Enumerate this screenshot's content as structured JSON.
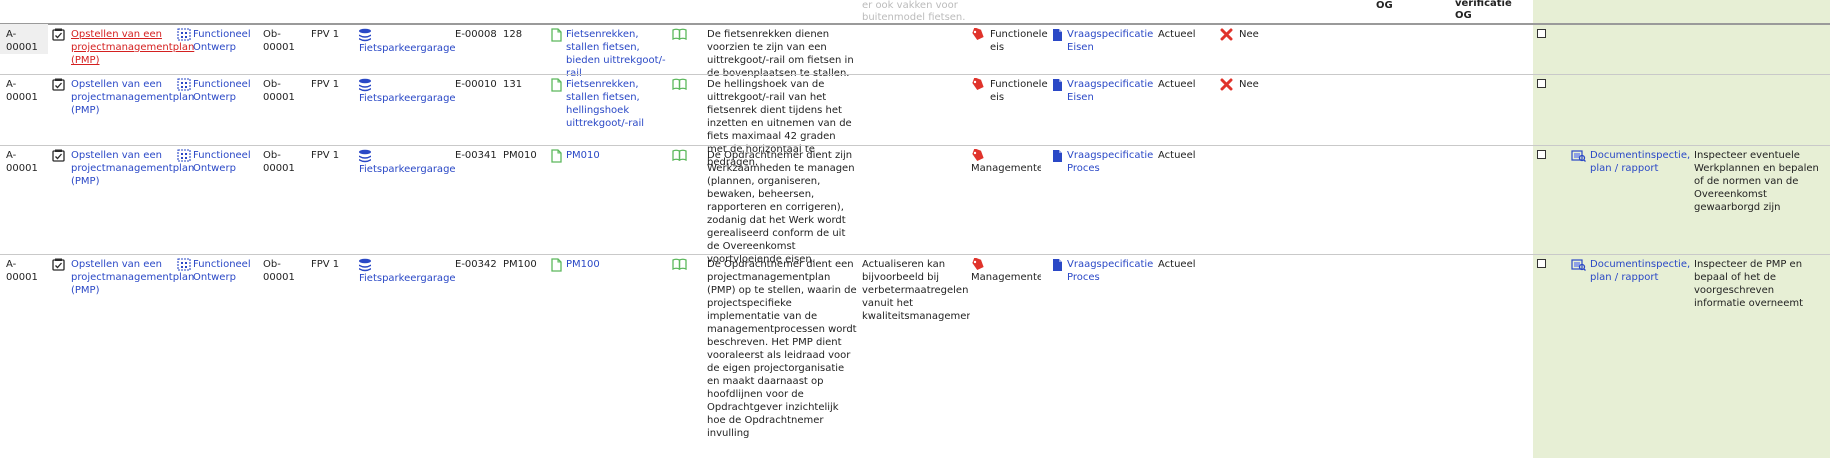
{
  "top": {
    "frag1": "er ook vakken voor",
    "frag2": "buitenmodel fietsen.",
    "og": "OG",
    "verif1": "verificatie",
    "verif2": "OG"
  },
  "rows": [
    {
      "id": "A-00001",
      "activity": "Opstellen van een projectmanagementplan (PMP)",
      "type": "Functioneel Ontwerp",
      "object": "Ob-00001",
      "phase": "FPV 1",
      "location": "Fietsparkeergarage",
      "eid": "E-00008",
      "num": "128",
      "req": "Fietsenrekken, stallen fietsen, bieden uittrekgoot/-rail",
      "desc": "De fietsenrekken dienen voorzien te zijn van een uittrekgoot/-rail om fietsen in de bovenplaatsen te stallen.",
      "note": "",
      "cat": "Functionele eis",
      "spec": "Vraagspecificatie Eisen",
      "status": "Actueel",
      "flag": "Nee",
      "verify_method": "",
      "verify_desc": ""
    },
    {
      "id": "A-00001",
      "activity": "Opstellen van een projectmanagementplan (PMP)",
      "type": "Functioneel Ontwerp",
      "object": "Ob-00001",
      "phase": "FPV 1",
      "location": "Fietsparkeergarage",
      "eid": "E-00010",
      "num": "131",
      "req": "Fietsenrekken, stallen fietsen, hellingshoek uittrekgoot/-rail",
      "desc": "De hellingshoek van de uittrekgoot/-rail van het fietsenrek dient tijdens het inzetten en uitnemen van de fiets maximaal 42 graden met de horizontaal te bedragen.",
      "note": "",
      "cat": "Functionele eis",
      "spec": "Vraagspecificatie Eisen",
      "status": "Actueel",
      "flag": "Nee",
      "verify_method": "",
      "verify_desc": ""
    },
    {
      "id": "A-00001",
      "activity": "Opstellen van een projectmanagementplan (PMP)",
      "type": "Functioneel Ontwerp",
      "object": "Ob-00001",
      "phase": "FPV 1",
      "location": "Fietsparkeergarage",
      "eid": "E-00341",
      "num": "PM010",
      "req": "PM010",
      "desc": "De Opdrachtnemer dient zijn Werkzaamheden te managen (plannen, organiseren, bewaken, beheersen, rapporteren en corrigeren), zodanig dat het Werk wordt gerealiseerd conform de uit de Overeenkomst voortvloeiende eisen.",
      "note": "",
      "cat": "Managementeis",
      "spec": "Vraagspecificatie Proces",
      "status": "Actueel",
      "flag": "",
      "verify_method": "Documentinspectie, plan / rapport",
      "verify_desc": "Inspecteer eventuele Werkplannen en bepalen of de normen van de Overeenkomst gewaarborgd zijn"
    },
    {
      "id": "A-00001",
      "activity": "Opstellen van een projectmanagementplan (PMP)",
      "type": "Functioneel Ontwerp",
      "object": "Ob-00001",
      "phase": "FPV 1",
      "location": "Fietsparkeergarage",
      "eid": "E-00342",
      "num": "PM100",
      "req": "PM100",
      "desc": "De Opdrachtnemer dient een projectmanagementplan (PMP) op te stellen, waarin de projectspecifieke implementatie van de managementprocessen wordt beschreven. Het PMP dient vooraleerst als leidraad voor de eigen projectorganisatie en maakt daarnaast op hoofdlijnen voor de Opdrachtgever inzichtelijk hoe de Opdrachtnemer invulling",
      "note": "Actualiseren kan bijvoorbeeld bij verbetermaatregelen vanuit het kwaliteitsmanagement.",
      "cat": "Managementeis",
      "spec": "Vraagspecificatie Proces",
      "status": "Actueel",
      "flag": "",
      "verify_method": "Documentinspectie, plan / rapport",
      "verify_desc": "Inspecteer de PMP en bepaal of het de voorgeschreven informatie overneemt"
    }
  ],
  "colors": {
    "link": "#2a48c6",
    "link_active": "#d42020",
    "green_panel": "#e7efd5",
    "req_icon": "#5cb85c",
    "tag_icon": "#e0332b",
    "spec_icon": "#2a48c6",
    "layers_icon": "#2a48c6",
    "nee_icon": "#e0332b"
  },
  "icons": {
    "activity": "checklist-icon",
    "type": "diagram-icon",
    "location": "layers-icon",
    "req": "document-icon",
    "book": "book-icon",
    "cat": "tag-icon",
    "spec": "file-icon",
    "flag": "cross-icon",
    "verify": "inspection-icon"
  }
}
